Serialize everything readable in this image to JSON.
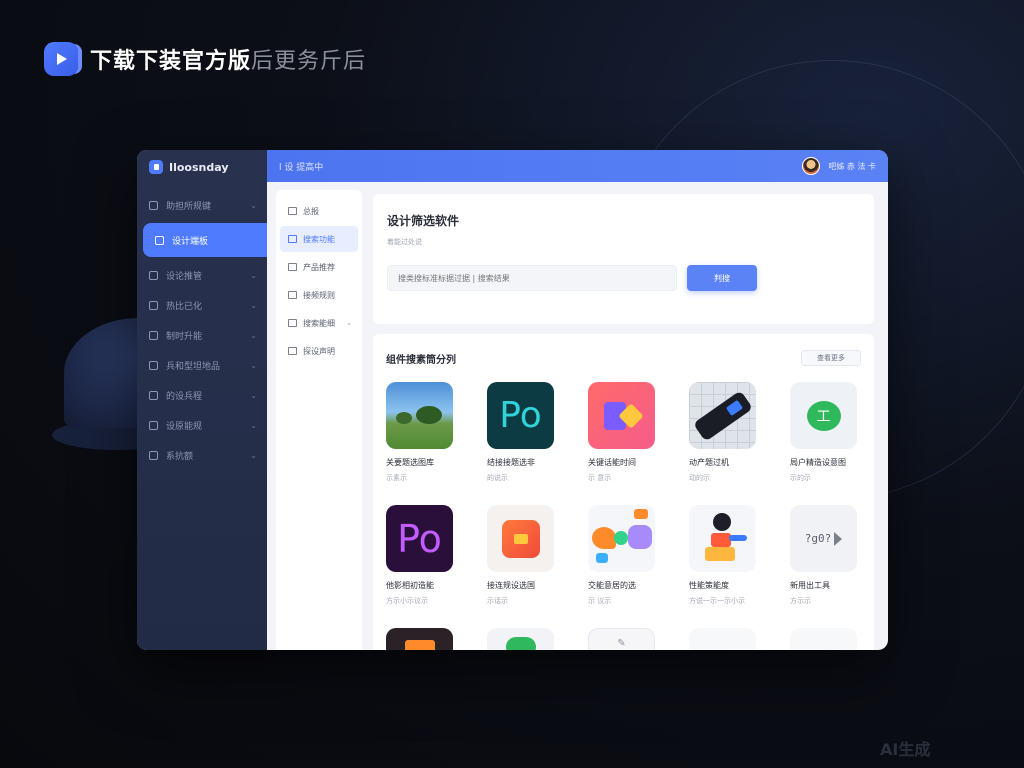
{
  "banner": {
    "title": "下载下装官方版",
    "subtitle": "后更务斤后"
  },
  "watermark": "AI生成",
  "app": {
    "brand": "Iloosnday",
    "breadcrumb": "l 设 提高中",
    "user_name": "吧姊 赤 法 卡"
  },
  "sidebar": {
    "items": [
      {
        "label": "助担所规键",
        "active": false,
        "chevron": true
      },
      {
        "label": "设计端板",
        "active": true,
        "chevron": false
      },
      {
        "label": "设论推管",
        "active": false,
        "chevron": true
      },
      {
        "label": "热比已化",
        "active": false,
        "chevron": true
      },
      {
        "label": "制时升能",
        "active": false,
        "chevron": true
      },
      {
        "label": "兵和型坦地品",
        "active": false,
        "chevron": true
      },
      {
        "label": "的设兵程",
        "active": false,
        "chevron": true
      },
      {
        "label": "设原能规",
        "active": false,
        "chevron": true
      },
      {
        "label": "系抗额",
        "active": false,
        "chevron": true
      }
    ]
  },
  "subnav": {
    "items": [
      {
        "label": "总报",
        "active": false,
        "chevron": false
      },
      {
        "label": "搜索功能",
        "active": true,
        "chevron": false
      },
      {
        "label": "产品推荐",
        "active": false,
        "chevron": false
      },
      {
        "label": "接频规则",
        "active": false,
        "chevron": false
      },
      {
        "label": "搜索能细",
        "active": false,
        "chevron": true
      },
      {
        "label": "探设声明",
        "active": false,
        "chevron": false
      }
    ]
  },
  "search": {
    "title": "设计筛选软件",
    "description": "着能过处说",
    "placeholder": "搜类搜标准标据过据 | 搜索结果",
    "button": "判搜"
  },
  "results": {
    "title": "组件搜素筒分列",
    "more": "查看更多",
    "apps": [
      {
        "name": "关要题选图库",
        "meta": "示素示",
        "icon": "landscape"
      },
      {
        "name": "结接接题选非",
        "meta": "的说示",
        "icon": "po-teal"
      },
      {
        "name": "关键话能时间",
        "meta": "示 意示",
        "icon": "coral"
      },
      {
        "name": "动产题过机",
        "meta": "动的示",
        "icon": "grid"
      },
      {
        "name": "局户精造设意图",
        "meta": "示的示",
        "icon": "bubble"
      },
      {
        "name": "他影相初造能",
        "meta": "方示小示议示",
        "icon": "po-purple"
      },
      {
        "name": "接连规设选国",
        "meta": "示话示",
        "icon": "orange"
      },
      {
        "name": "交能意居的选",
        "meta": "示 议示",
        "icon": "shapes"
      },
      {
        "name": "性能策能度",
        "meta": "方说一示一示小示",
        "icon": "person"
      },
      {
        "name": "新用出工具",
        "meta": "方示示",
        "icon": "text"
      },
      {
        "name": "",
        "meta": "",
        "icon": "dark"
      },
      {
        "name": "",
        "meta": "",
        "icon": "soft"
      },
      {
        "name": "",
        "meta": "",
        "icon": "sketch"
      },
      {
        "name": "",
        "meta": "",
        "icon": "blank"
      },
      {
        "name": "",
        "meta": "",
        "icon": "blank"
      }
    ],
    "text_icon_label": "?g0?"
  },
  "colors": {
    "accent": "#4f7bff",
    "sidebar": "#252e4a",
    "topbar": "#4c74f0"
  }
}
